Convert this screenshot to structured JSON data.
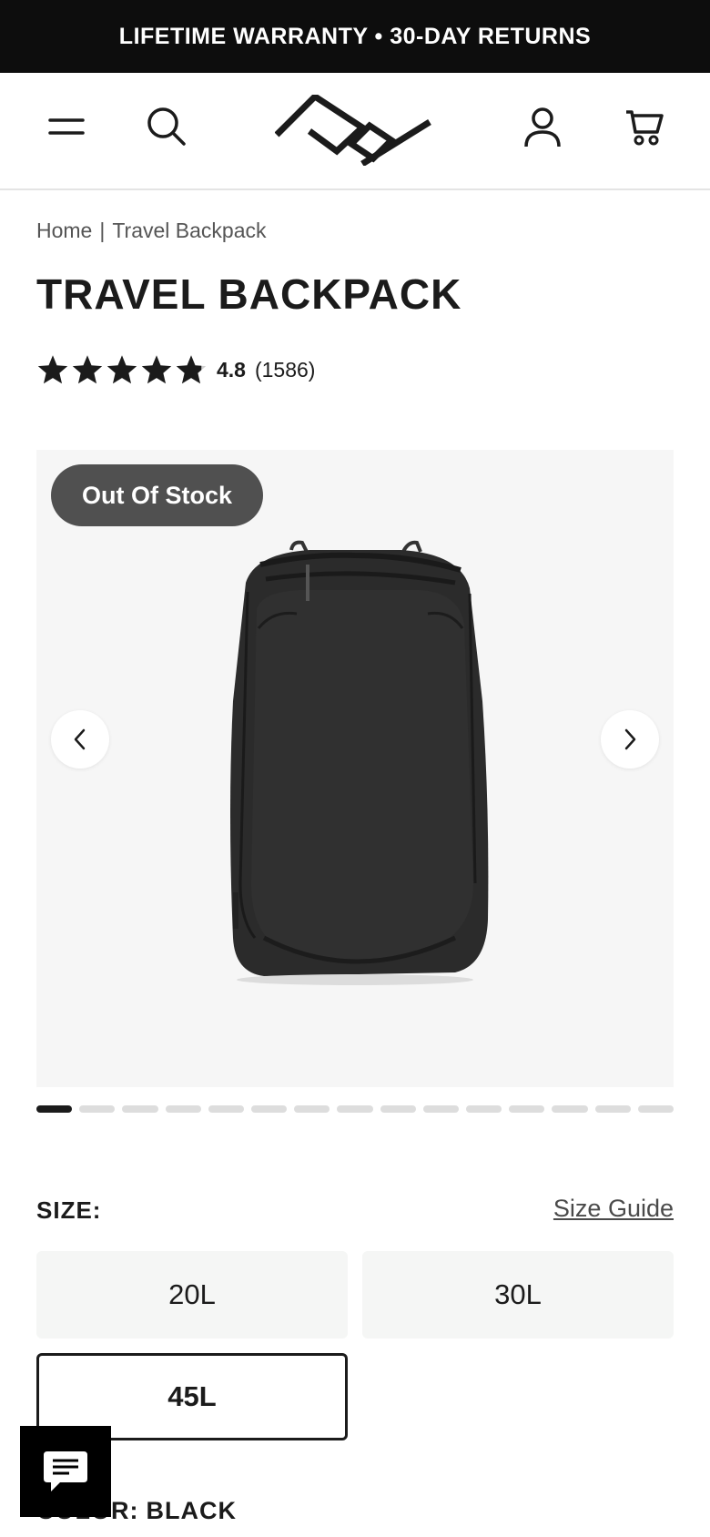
{
  "promo": {
    "text": "LIFETIME WARRANTY • 30-DAY RETURNS"
  },
  "header": {
    "menu_icon": "hamburger-menu-icon",
    "search_icon": "search-icon",
    "logo": "peak-design-logo",
    "account_icon": "user-account-icon",
    "cart_icon": "shopping-cart-icon"
  },
  "breadcrumb": {
    "home": "Home",
    "separator": "|",
    "current": "Travel Backpack"
  },
  "product": {
    "title": "TRAVEL BACKPACK",
    "rating": {
      "score": "4.8",
      "count": "(1586)",
      "stars_value": 4.8,
      "stars_max": 5
    },
    "badge": "Out Of Stock",
    "gallery": {
      "current_slide": 1,
      "total_slides": 15
    }
  },
  "size": {
    "label": "SIZE:",
    "guide_link": "Size Guide",
    "options": [
      "20L",
      "30L",
      "45L"
    ],
    "selected": "45L"
  },
  "color": {
    "label": "COLOR:",
    "value": "BLACK"
  },
  "chat": {
    "icon": "chat-bubble-icon"
  },
  "colors": {
    "promo_bg": "#0d0d0d",
    "badge_bg": "#505050",
    "option_bg": "#f5f6f5",
    "text": "#1b1b1b"
  }
}
